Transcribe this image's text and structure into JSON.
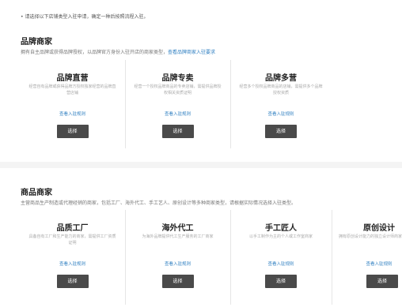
{
  "notice": "• 请选择以下店铺类型入驻申请，确定一种后按照流程入驻。",
  "brand": {
    "title": "品牌商家",
    "desc": "拥有自主品牌或获得品牌授权，以品牌官方身份入驻开店的商家类型，",
    "desc_link": "查看品牌商家入驻要求",
    "cards": [
      {
        "title": "品牌直营",
        "desc": "经营自有品牌或获得品牌方授权独家经营的品牌直营店铺",
        "rules": "查看入驻规则",
        "button": "选择"
      },
      {
        "title": "品牌专卖",
        "desc": "经营一个授权品牌商品的专卖店铺，需提供品牌授权相关资质证明",
        "rules": "查看入驻规则",
        "button": "选择"
      },
      {
        "title": "品牌多营",
        "desc": "经营多个授权品牌商品的店铺，需提供多个品牌授权资质",
        "rules": "查看入驻规则",
        "button": "选择"
      }
    ]
  },
  "goods": {
    "title": "商品商家",
    "desc": "主营商品生产制造或代理经销的商家，包括工厂、海外代工、手工艺人、原创设计等多种商家类型，请根据实际情况选择入驻类型。",
    "cards": [
      {
        "title": "品质工厂",
        "desc": "具备自有工厂和生产能力的商家，需提供工厂资质证明",
        "rules": "查看入驻规则",
        "button": "选择"
      },
      {
        "title": "海外代工",
        "desc": "为海外品牌提供代工生产服务的工厂商家",
        "rules": "查看入驻规则",
        "button": "选择"
      },
      {
        "title": "手工匠人",
        "desc": "以手工制作为主的个人或工作室商家",
        "rules": "查看入驻规则",
        "button": "选择"
      },
      {
        "title": "原创设计",
        "desc": "拥有原创设计能力的独立设计师商家",
        "rules": "查看入驻规则",
        "button": "选择"
      }
    ]
  },
  "colors": {
    "button": "#4a4a4a",
    "link": "#2f7fc1",
    "divider": "#f4f4f4"
  }
}
